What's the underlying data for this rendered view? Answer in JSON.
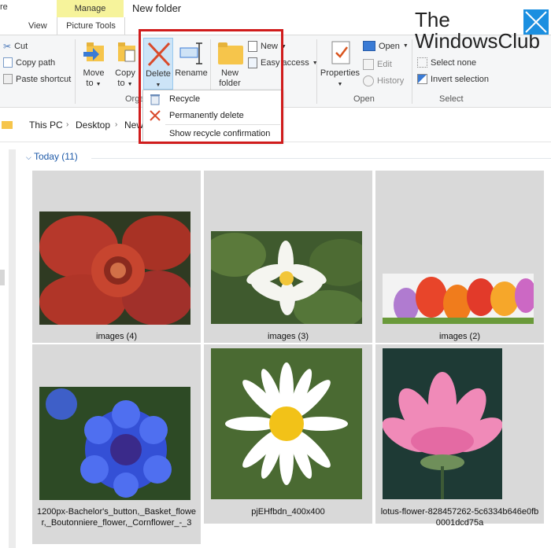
{
  "window": {
    "title": "New folder",
    "contextual_tab": "Manage",
    "left_edge_tab_fragment": "re"
  },
  "tabs": {
    "view": "View",
    "picture_tools": "Picture Tools"
  },
  "ribbon": {
    "clipboard": {
      "cut": "Cut",
      "copy_path": "Copy path",
      "paste_shortcut": "Paste shortcut"
    },
    "organize": {
      "move_to_line1": "Move",
      "move_to_line2": "to",
      "copy_to_line1": "Copy",
      "copy_to_line2": "to",
      "delete": "Delete",
      "rename": "Rename",
      "group_label_fragment": "Orga"
    },
    "new": {
      "new_folder_line1": "New",
      "new_folder_line2": "folder",
      "new_item": "New",
      "easy_access": "Easy access"
    },
    "open": {
      "properties": "Properties",
      "open": "Open",
      "edit": "Edit",
      "history": "History",
      "group_label": "Open"
    },
    "select": {
      "select_none": "Select none",
      "invert_selection": "Invert selection",
      "group_label": "Select"
    }
  },
  "delete_menu": {
    "items": [
      {
        "label": "Recycle",
        "icon": "recycle-bin-icon"
      },
      {
        "label": "Permanently delete",
        "icon": "delete-x-icon"
      },
      {
        "label": "Show recycle confirmation",
        "icon": ""
      }
    ]
  },
  "address": {
    "crumbs": [
      "This PC",
      "Desktop",
      "New"
    ]
  },
  "content": {
    "group_header": "Today (11)",
    "files": [
      {
        "caption": "images (4)",
        "image": "rafflesia-flower"
      },
      {
        "caption": "images (3)",
        "image": "white-water-lily"
      },
      {
        "caption": "images (2)",
        "image": "colorful-tulips"
      },
      {
        "caption": "1200px-Bachelor's_button,_Basket_flower,_Boutonniere_flower,_Cornflower_-_3",
        "image": "blue-cornflower"
      },
      {
        "caption": "pjEHfbdn_400x400",
        "image": "white-daisy"
      },
      {
        "caption": "lotus-flower-828457262-5c6334b646e0fb0001dcd75a",
        "image": "pink-lotus"
      }
    ]
  },
  "watermark": {
    "line1": "The",
    "line2": "WindowsClub"
  },
  "colors": {
    "highlight_border": "#d01c1c",
    "manage_tab": "#f6f39b",
    "tile_selected": "#d9d9d9",
    "link_blue": "#1e5aa8"
  }
}
